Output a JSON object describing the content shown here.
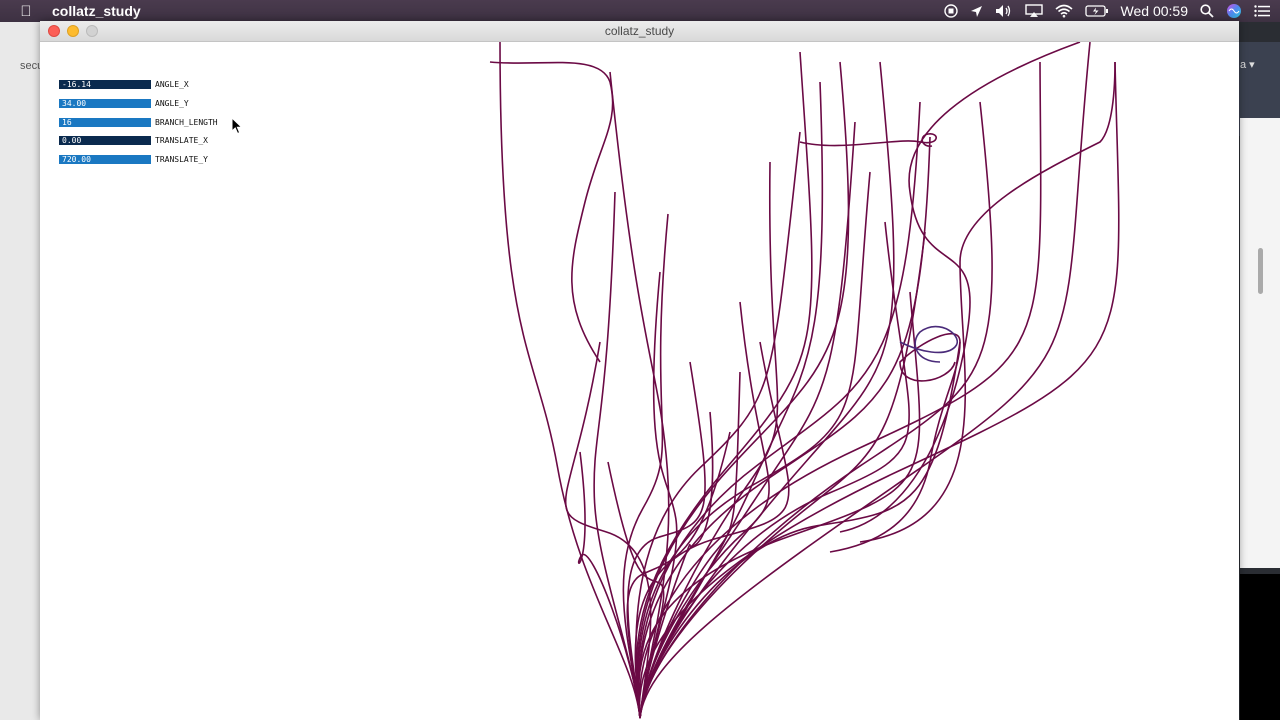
{
  "menubar": {
    "app_name": "collatz_study",
    "clock": "Wed 00:59",
    "icons": [
      "apple-icon",
      "record-icon",
      "location-icon",
      "volume-icon",
      "airplay-icon",
      "wifi-icon",
      "battery-icon",
      "search-icon",
      "siri-icon",
      "list-icon"
    ]
  },
  "background": {
    "left_tab_text": "secu",
    "right_text": "a ▾"
  },
  "window": {
    "title": "collatz_study"
  },
  "sliders": [
    {
      "value_text": "-16.14",
      "label": "ANGLE_X",
      "level": 0.52,
      "fill_color": "#0a2a4e"
    },
    {
      "value_text": "34.00",
      "label": "ANGLE_Y",
      "level": 1.0,
      "fill_color": "#1a78c2"
    },
    {
      "value_text": "16",
      "label": "BRANCH_LENGTH",
      "level": 1.0,
      "fill_color": "#1a78c2"
    },
    {
      "value_text": "0.00",
      "label": "TRANSLATE_X",
      "level": 0.0,
      "fill_color": "#1a78c2"
    },
    {
      "value_text": "720.00",
      "label": "TRANSLATE_Y",
      "level": 1.0,
      "fill_color": "#1a78c2"
    }
  ],
  "colors": {
    "stroke": "#6b0a45",
    "track": "#0a2a4e",
    "fill": "#1a78c2"
  }
}
